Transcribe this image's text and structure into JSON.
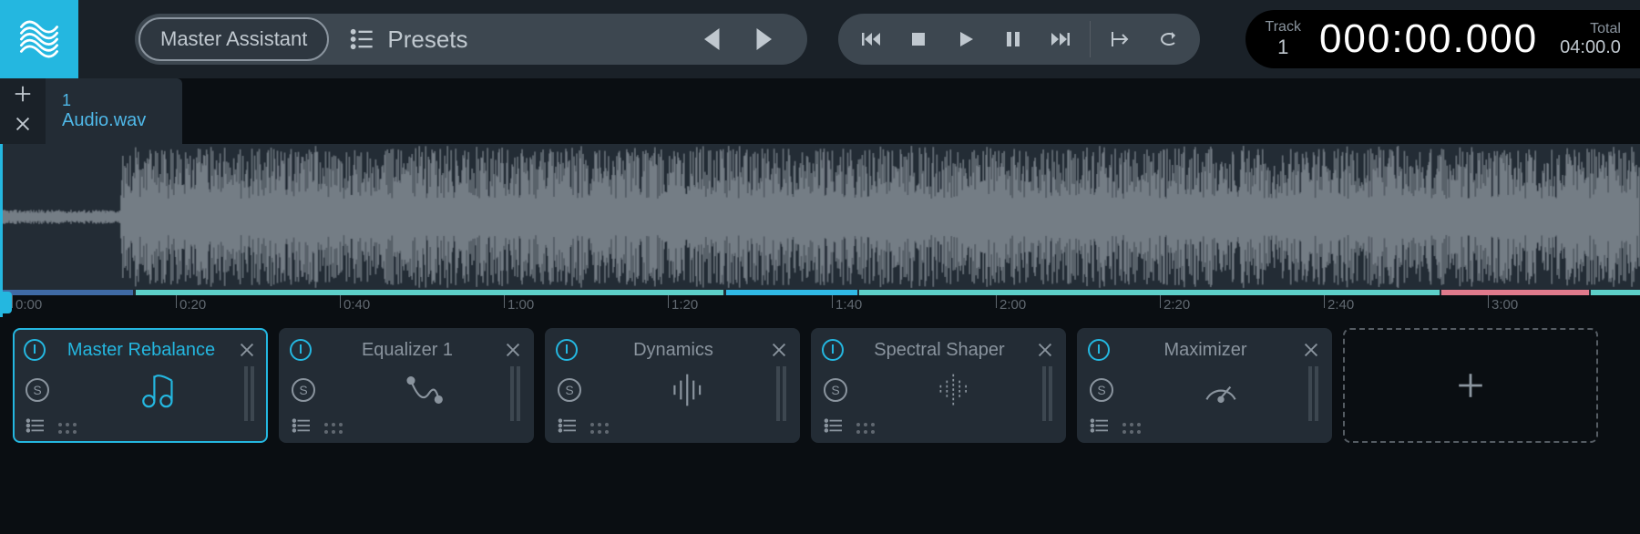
{
  "toolbar": {
    "master_assistant": "Master Assistant",
    "presets_label": "Presets"
  },
  "time": {
    "track_label": "Track",
    "track_number": "1",
    "main_time": "000:00.000",
    "total_label": "Total",
    "total_time": "04:00.0"
  },
  "tab": {
    "number": "1",
    "filename": "Audio.wav"
  },
  "ruler_labels": [
    "0:00",
    "0:20",
    "0:40",
    "1:00",
    "1:20",
    "1:40",
    "2:00",
    "2:20",
    "2:40",
    "3:00"
  ],
  "timeline_segments": [
    {
      "color": "#3f6aa5",
      "flex": 0.08
    },
    {
      "color": "transparent",
      "flex": 0.0015
    },
    {
      "color": "#5dd0c9",
      "flex": 0.36
    },
    {
      "color": "transparent",
      "flex": 0.0015
    },
    {
      "color": "#30b9e6",
      "flex": 0.08
    },
    {
      "color": "transparent",
      "flex": 0.0015
    },
    {
      "color": "#5dd0c9",
      "flex": 0.355
    },
    {
      "color": "transparent",
      "flex": 0.0015
    },
    {
      "color": "#e07a8c",
      "flex": 0.09
    },
    {
      "color": "transparent",
      "flex": 0.0015
    },
    {
      "color": "#5dd0c9",
      "flex": 0.03
    }
  ],
  "modules": [
    {
      "title": "Master Rebalance",
      "active": true,
      "icon": "rebalance"
    },
    {
      "title": "Equalizer 1",
      "active": false,
      "icon": "eq"
    },
    {
      "title": "Dynamics",
      "active": false,
      "icon": "dynamics"
    },
    {
      "title": "Spectral Shaper",
      "active": false,
      "icon": "spectral"
    },
    {
      "title": "Maximizer",
      "active": false,
      "icon": "maximizer"
    }
  ]
}
